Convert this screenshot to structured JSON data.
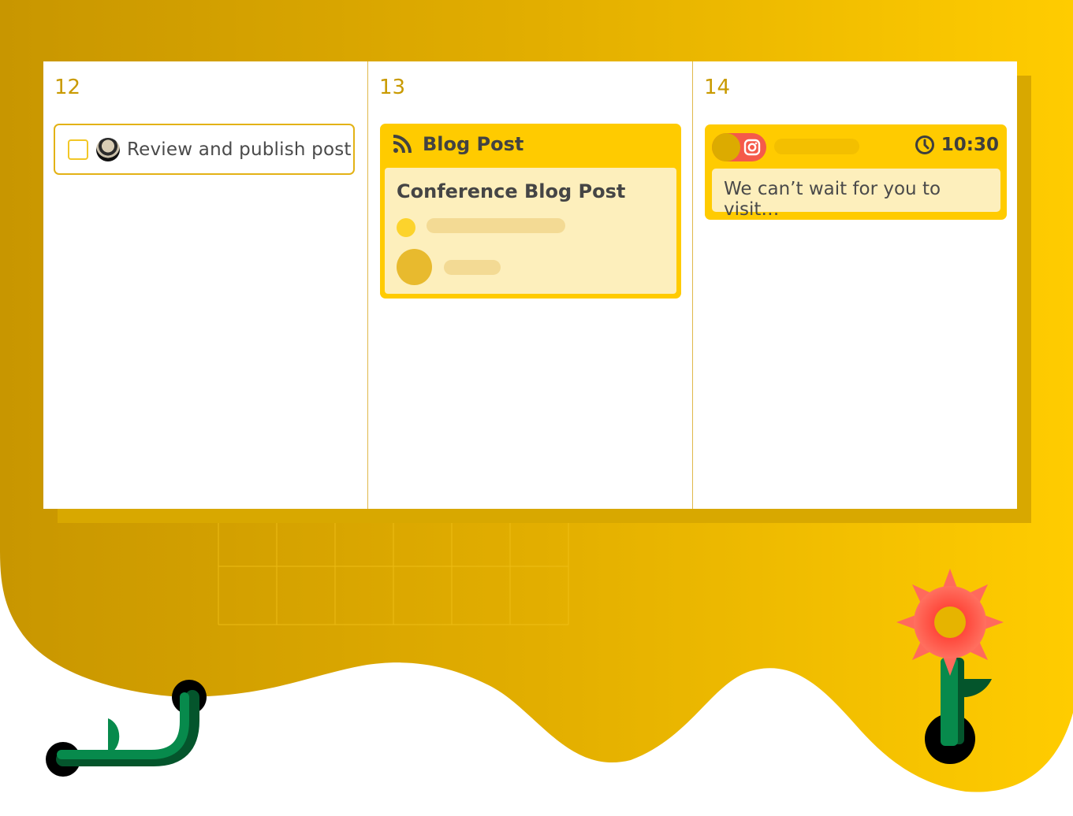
{
  "calendar": {
    "days": [
      {
        "number": "12"
      },
      {
        "number": "13"
      },
      {
        "number": "14"
      }
    ]
  },
  "task": {
    "checked": false,
    "avatar": "user-avatar",
    "text": "Review and publish post"
  },
  "blog_card": {
    "icon": "rss-icon",
    "type_label": "Blog Post",
    "title": "Conference Blog Post"
  },
  "social_card": {
    "network_icon": "instagram-icon",
    "toggle_on": true,
    "time_icon": "clock-icon",
    "time": "10:30",
    "preview_text": "We can’t wait for you to visit…"
  },
  "colors": {
    "accent_yellow": "#ffcb00",
    "dark_gold": "#c99a00",
    "card_cream": "#fdefbc",
    "instagram_red": "#f55a4a",
    "flower_red": "#ff5a4a",
    "stem_green": "#078a4c",
    "stem_dark_green": "#04552c"
  },
  "decorations": [
    {
      "name": "sprout-illustration"
    },
    {
      "name": "flower-illustration"
    }
  ]
}
